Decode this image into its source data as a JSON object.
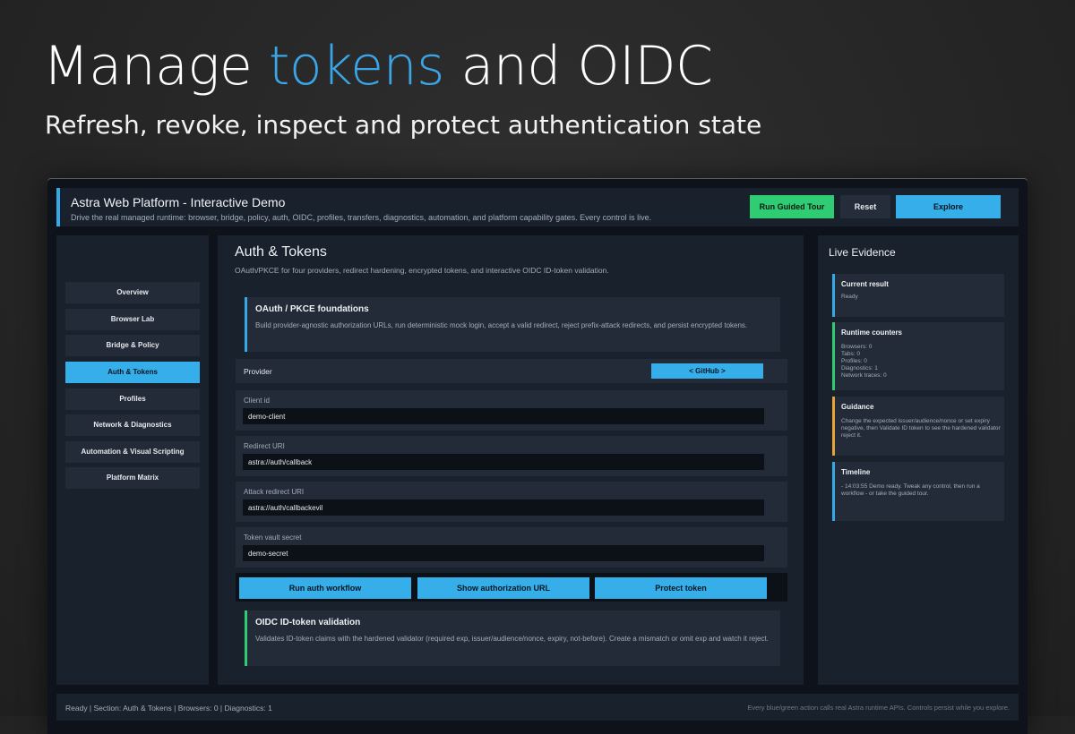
{
  "hero": {
    "title_prefix": "Manage ",
    "title_accent": "tokens",
    "title_suffix": " and OIDC",
    "subtitle": "Refresh, revoke, inspect and protect authentication state"
  },
  "app": {
    "title": "Astra Web Platform - Interactive Demo",
    "description": "Drive the real managed runtime: browser, bridge, policy, auth, OIDC, profiles, transfers, diagnostics, automation, and platform capability gates. Every control is live.",
    "buttons": {
      "tour": "Run Guided Tour",
      "reset": "Reset",
      "explore": "Explore"
    }
  },
  "sidebar": {
    "items": [
      {
        "label": "Overview",
        "active": false
      },
      {
        "label": "Browser Lab",
        "active": false
      },
      {
        "label": "Bridge & Policy",
        "active": false
      },
      {
        "label": "Auth & Tokens",
        "active": true
      },
      {
        "label": "Profiles",
        "active": false
      },
      {
        "label": "Network & Diagnostics",
        "active": false
      },
      {
        "label": "Automation & Visual Scripting",
        "active": false
      },
      {
        "label": "Platform Matrix",
        "active": false
      }
    ]
  },
  "main": {
    "title": "Auth & Tokens",
    "description": "OAuth/PKCE for four providers, redirect hardening, encrypted tokens, and interactive OIDC ID-token validation.",
    "oauth_card": {
      "title": "OAuth / PKCE foundations",
      "text": "Build provider-agnostic authorization URLs, run deterministic mock login, accept a valid redirect, reject prefix-attack redirects, and persist encrypted tokens."
    },
    "provider": {
      "label": "Provider",
      "value": "< GitHub >"
    },
    "fields": [
      {
        "label": "Client id",
        "value": "demo-client"
      },
      {
        "label": "Redirect URI",
        "value": "astra://auth/callback"
      },
      {
        "label": "Attack redirect URI",
        "value": "astra://auth/callbackevil"
      },
      {
        "label": "Token vault secret",
        "value": "demo-secret"
      }
    ],
    "actions": {
      "run": "Run auth workflow",
      "show_url": "Show authorization URL",
      "protect": "Protect token"
    },
    "oidc_card": {
      "title": "OIDC ID-token validation",
      "text": "Validates ID-token claims with the hardened validator (required exp, issuer/audience/nonce, expiry, not-before). Create a mismatch or omit exp and watch it reject."
    }
  },
  "evidence": {
    "title": "Live Evidence",
    "current": {
      "title": "Current result",
      "body": "Ready"
    },
    "counters": {
      "title": "Runtime counters",
      "lines": [
        "Browsers: 0",
        "Tabs: 0",
        "Profiles: 0",
        "Diagnostics: 1",
        "Network traces: 0"
      ]
    },
    "guidance": {
      "title": "Guidance",
      "body": "Change the expected issuer/audience/nonce or set expiry negative, then Validate ID token to see the hardened validator reject it."
    },
    "timeline": {
      "title": "Timeline",
      "body": "- 14:03:55 Demo ready. Tweak any control, then run a workflow - or take the guided tour."
    }
  },
  "status": {
    "left": "Ready  |  Section: Auth & Tokens  |  Browsers: 0  |  Diagnostics: 1",
    "right": "Every blue/green action calls real Astra runtime APIs. Controls persist while you explore."
  },
  "colors": {
    "accent_blue": "#35aee9",
    "accent_green": "#2fcc73",
    "accent_amber": "#e8a23a",
    "panel": "#19212c",
    "card": "#222b37"
  }
}
